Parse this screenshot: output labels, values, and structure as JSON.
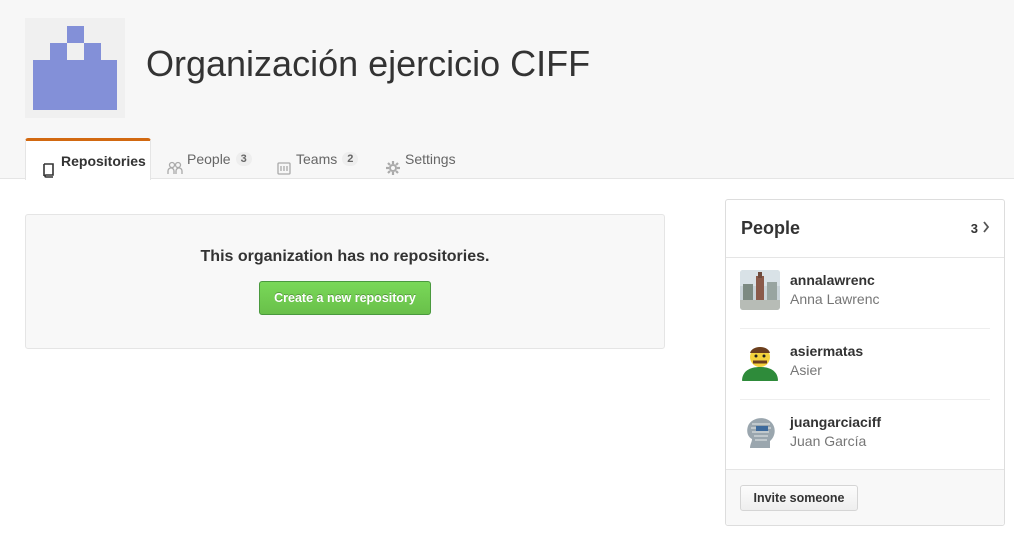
{
  "org": {
    "name": "Organización ejercicio CIFF",
    "avatar_color": "#8390d8"
  },
  "tabs": [
    {
      "label": "Repositories",
      "icon": "repo-icon",
      "selected": true
    },
    {
      "label": "People",
      "icon": "people-icon",
      "count": "3"
    },
    {
      "label": "Teams",
      "icon": "teams-icon",
      "count": "2"
    },
    {
      "label": "Settings",
      "icon": "gear-icon"
    }
  ],
  "repositories": {
    "empty_message": "This organization has no repositories.",
    "create_button": "Create a new repository"
  },
  "people_panel": {
    "title": "People",
    "count": "3",
    "members": [
      {
        "login": "annalawrenc",
        "name": "Anna Lawrenc",
        "avatar": "photo-avatar"
      },
      {
        "login": "asiermatas",
        "name": "Asier",
        "avatar": "cartoon-avatar"
      },
      {
        "login": "juangarciaciff",
        "name": "Juan García",
        "avatar": "word-cloud-head-avatar"
      }
    ],
    "invite_button": "Invite someone"
  },
  "colors": {
    "tab_accent": "#d26911",
    "primary_button": "#6cc644"
  }
}
